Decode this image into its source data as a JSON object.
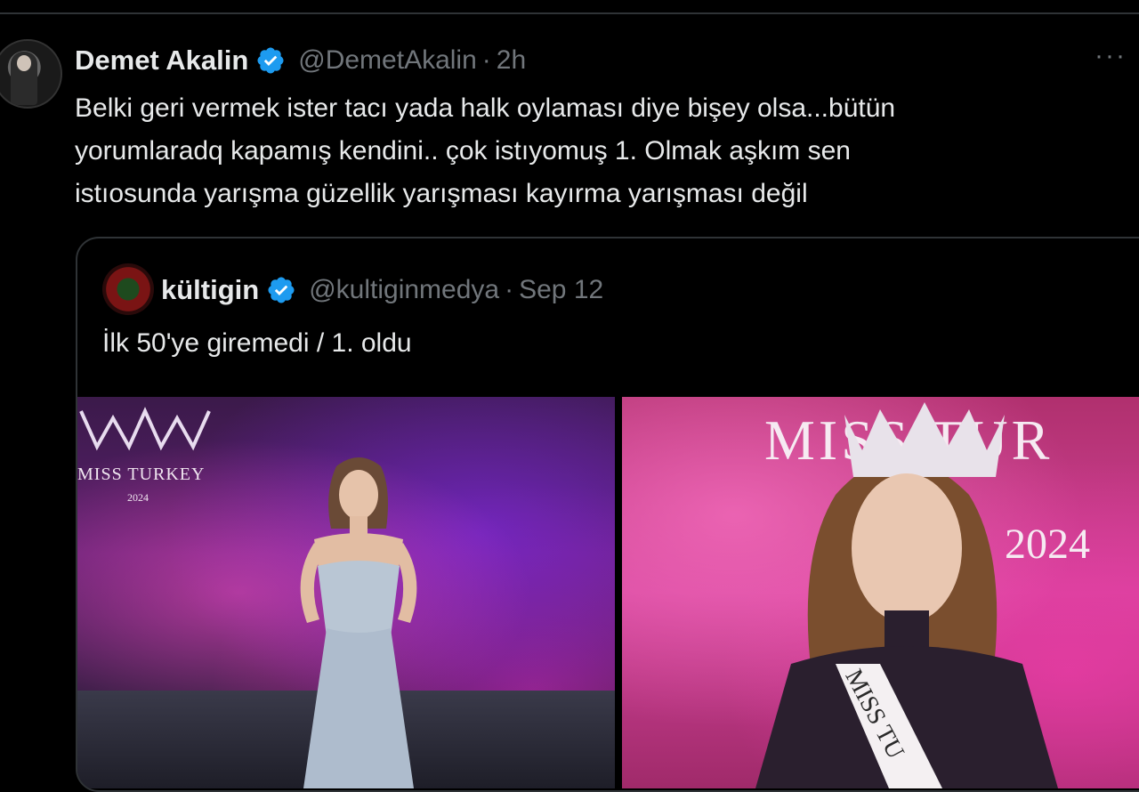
{
  "tweet": {
    "author_name": "Demet Akalin",
    "handle": "@DemetAkalin",
    "separator": "·",
    "time": "2h",
    "more": "···",
    "text_lines": [
      "Belki geri vermek ister tacı yada halk oylaması diye bişey olsa...bütün",
      "yorumlaradq kapamış kendini.. çok istıyomuş 1. Olmak aşkım sen",
      "istıosunda yarışma güzellik yarışması kayırma yarışması değil"
    ]
  },
  "quote": {
    "author_name": "kültigin",
    "handle": "@kultiginmedya",
    "separator": "·",
    "date": "Sep 12",
    "text": "İlk 50'ye giremedi / 1. oldu",
    "left_photo": {
      "logo_text": "MISS TURKEY",
      "year": "2024"
    },
    "right_photo": {
      "backdrop_text": "MISS TUR",
      "year": "2024",
      "sash_text": "MISS TU"
    }
  },
  "colors": {
    "background": "#000000",
    "text": "#e7e9ea",
    "muted": "#71767b",
    "verified": "#1d9bf0",
    "border": "#2f3336"
  },
  "icons": [
    "verified-badge-icon",
    "more-options-icon"
  ]
}
